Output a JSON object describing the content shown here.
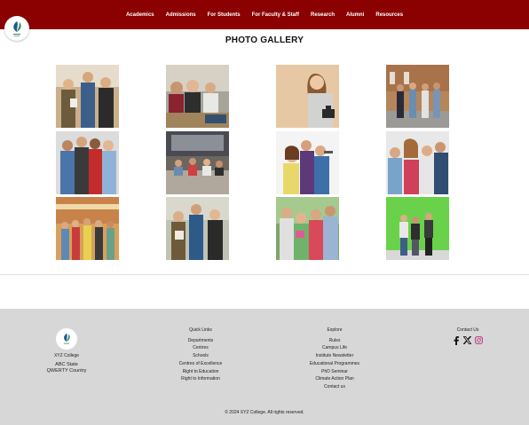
{
  "nav": {
    "items": [
      "Academics",
      "Admissions",
      "For Students",
      "For Faculty & Staff",
      "Research",
      "Alumni",
      "Resources"
    ]
  },
  "gallery": {
    "title": "PHOTO GALLERY",
    "photos": [
      "students-group-outdoor",
      "students-studying-table",
      "student-with-camera",
      "students-walking-campus",
      "students-group-casual",
      "students-sitting-steps",
      "students-selfie",
      "students-group-smiling",
      "students-friends-autumn",
      "students-park",
      "students-group-greenery",
      "students-green-wall"
    ]
  },
  "footer": {
    "college_name": "XYZ College",
    "address_line1": "ABC State",
    "address_line2": "QWERTY Country",
    "quick_links": {
      "heading": "Quick Links",
      "items": [
        "Departments",
        "Centres",
        "Schools",
        "Centres of Excellence",
        "Right to Education",
        "Right to Information"
      ]
    },
    "explore": {
      "heading": "Explore",
      "items": [
        "Rules",
        "Campus Life",
        "Institute Newsletter",
        "Educational Programmes",
        "PhD Seminar",
        "Climate Action Plan",
        "Contact us"
      ]
    },
    "contact": {
      "heading": "Contact Us",
      "icons": [
        "facebook-icon",
        "x-icon",
        "instagram-icon"
      ]
    },
    "copyright": "© 2024 XYZ College. All rights reserved."
  },
  "colors": {
    "header": "#8b0000",
    "footer": "#d7d7d7",
    "logo_green": "#2e8b57",
    "logo_blue": "#1e5a8c"
  }
}
